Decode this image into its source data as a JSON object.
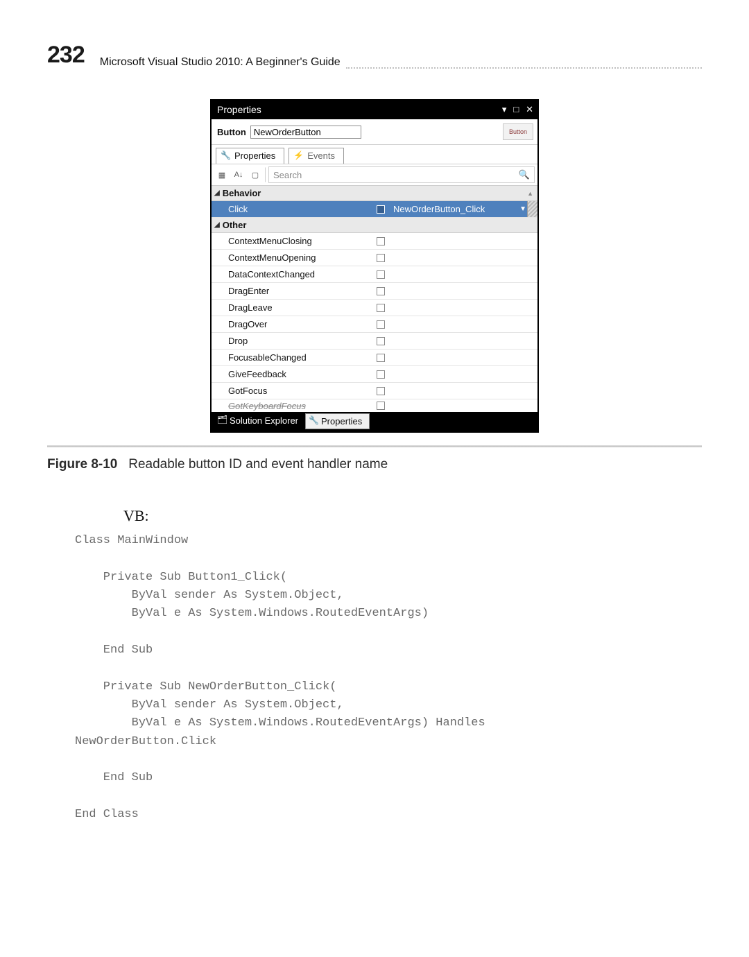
{
  "page": {
    "number": "232",
    "book_title": "Microsoft Visual Studio 2010: A Beginner's Guide"
  },
  "propwin": {
    "title": "Properties",
    "obj_label": "Button",
    "obj_name": "NewOrderButton",
    "badge": "Button",
    "tab_properties": "Properties",
    "tab_events": "Events",
    "search_placeholder": "Search",
    "cat_behavior": "Behavior",
    "cat_other": "Other",
    "selected_event": "Click",
    "selected_value": "NewOrderButton_Click",
    "events": [
      "ContextMenuClosing",
      "ContextMenuOpening",
      "DataContextChanged",
      "DragEnter",
      "DragLeave",
      "DragOver",
      "Drop",
      "FocusableChanged",
      "GiveFeedback",
      "GotFocus"
    ],
    "cutoff_event": "GotKeyboardFocus",
    "bottom_tab_solution": "Solution Explorer",
    "bottom_tab_properties": "Properties"
  },
  "figure": {
    "label": "Figure 8-10",
    "caption": "Readable button ID and event handler name"
  },
  "code": {
    "lang_label": "VB:",
    "text": "Class MainWindow\n\n    Private Sub Button1_Click(\n        ByVal sender As System.Object,\n        ByVal e As System.Windows.RoutedEventArgs)\n\n    End Sub\n\n    Private Sub NewOrderButton_Click(\n        ByVal sender As System.Object,\n        ByVal e As System.Windows.RoutedEventArgs) Handles\nNewOrderButton.Click\n\n    End Sub\n\nEnd Class"
  }
}
